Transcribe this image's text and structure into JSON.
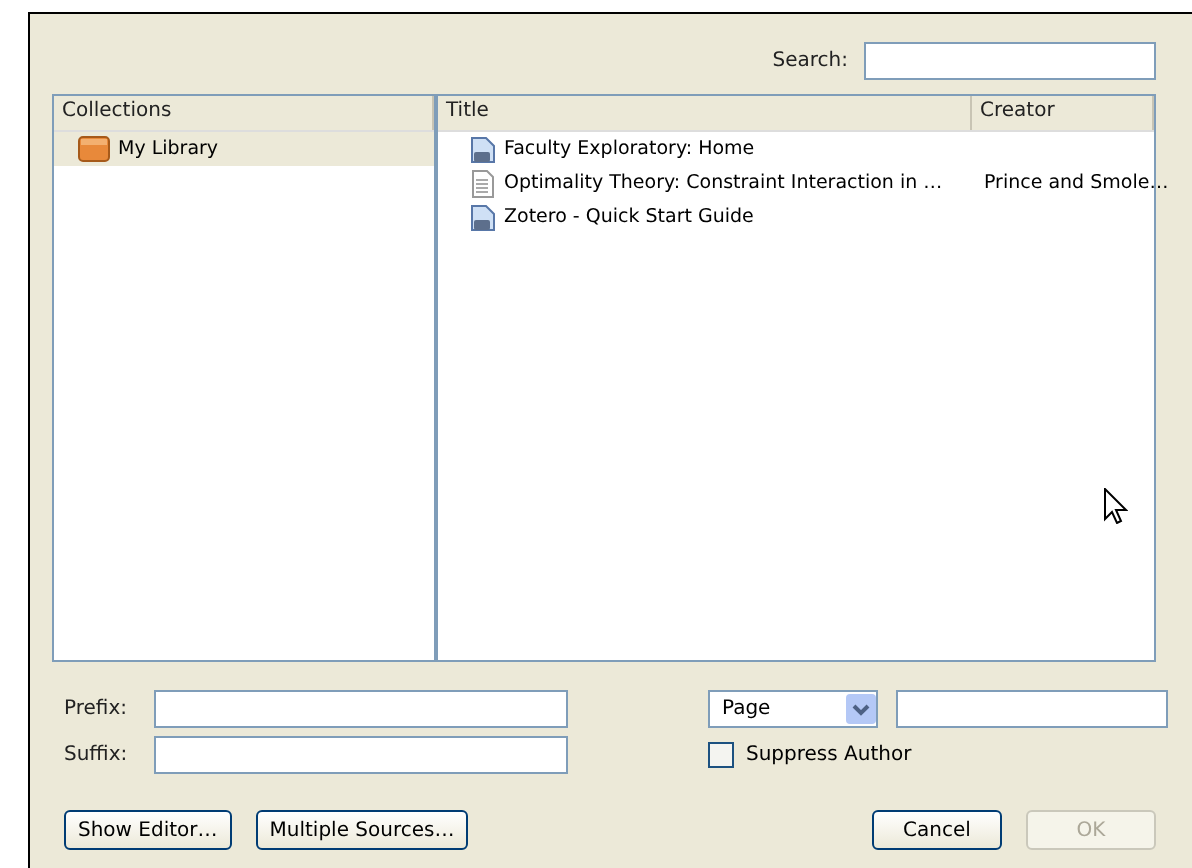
{
  "search": {
    "label": "Search:"
  },
  "collections": {
    "header": "Collections",
    "items": [
      {
        "label": "My Library",
        "selected": true
      }
    ]
  },
  "items": {
    "columns": [
      "Title",
      "Creator"
    ],
    "rows": [
      {
        "kind": "webpage",
        "title": "Faculty Exploratory: Home",
        "creator": "",
        "selected": false
      },
      {
        "kind": "document",
        "title": "Optimality Theory: Constraint Interaction in …",
        "creator": "Prince and Smole…",
        "selected": false
      },
      {
        "kind": "webpage",
        "title": "Zotero - Quick Start Guide",
        "creator": "",
        "selected": false
      }
    ]
  },
  "prefix": {
    "label": "Prefix:"
  },
  "suffix": {
    "label": "Suffix:"
  },
  "locator": {
    "value": "Page"
  },
  "suppress_author": {
    "label": "Suppress Author",
    "checked": false
  },
  "buttons": [
    {
      "label": "Show Editor…",
      "disabled": false
    },
    {
      "label": "Multiple Sources…",
      "disabled": false
    }
  ],
  "dialog_buttons": [
    {
      "label": "Cancel",
      "disabled": false
    },
    {
      "label": "OK",
      "disabled": true
    }
  ]
}
